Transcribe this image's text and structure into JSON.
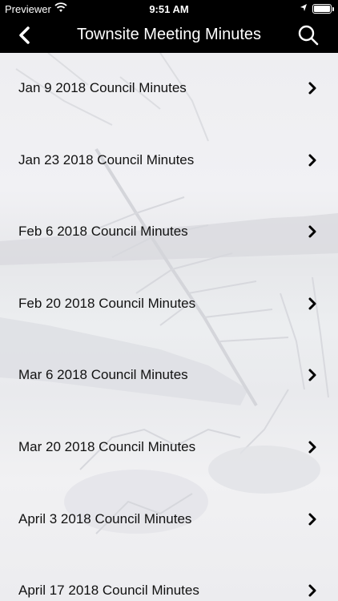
{
  "status_bar": {
    "carrier": "Previewer",
    "time": "9:51 AM",
    "battery_level": 0.9
  },
  "nav": {
    "title": "Townsite Meeting Minutes",
    "back_icon": "chevron-left-icon",
    "search_icon": "search-icon"
  },
  "items": [
    {
      "label": "Jan 9 2018 Council Minutes"
    },
    {
      "label": "Jan 23 2018 Council Minutes"
    },
    {
      "label": "Feb 6 2018 Council Minutes"
    },
    {
      "label": "Feb 20 2018 Council Minutes"
    },
    {
      "label": "Mar 6 2018 Council Minutes"
    },
    {
      "label": "Mar 20 2018 Council Minutes"
    },
    {
      "label": "April 3 2018 Council Minutes"
    },
    {
      "label": "April 17 2018 Council Minutes"
    }
  ]
}
